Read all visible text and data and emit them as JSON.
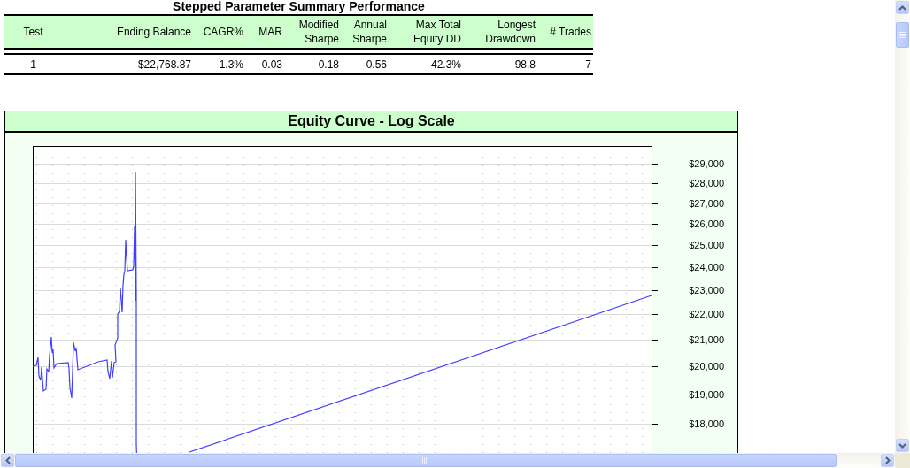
{
  "report_title": "Stepped Parameter Summary Performance",
  "table": {
    "columns": [
      {
        "label": "Test"
      },
      {
        "label": "Ending Balance"
      },
      {
        "label": "CAGR%"
      },
      {
        "label": "MAR"
      },
      {
        "label": "Modified\nSharpe"
      },
      {
        "label": "Annual\nSharpe"
      },
      {
        "label": "Max Total\nEquity DD"
      },
      {
        "label": "Longest\nDrawdown"
      },
      {
        "label": "# Trades"
      }
    ],
    "rows": [
      {
        "cells": [
          "1",
          "$22,768.87",
          "1.3%",
          "0.03",
          "0.18",
          "-0.56",
          "42.3%",
          "98.8",
          "7"
        ]
      }
    ]
  },
  "chart_panel": {
    "title": "Equity Curve - Log Scale",
    "y_axis_labels": [
      "$29,000",
      "$28,000",
      "$27,000",
      "$26,000",
      "$25,000",
      "$24,000",
      "$23,000",
      "$22,000",
      "$21,000",
      "$20,000",
      "$19,000",
      "$18,000"
    ]
  }
}
